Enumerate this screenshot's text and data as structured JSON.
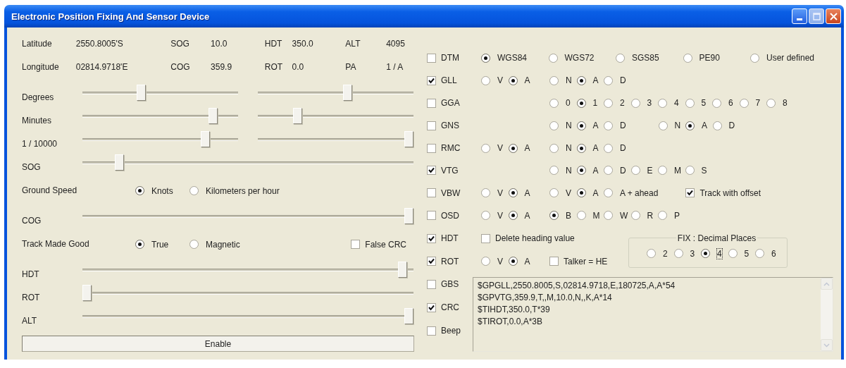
{
  "window": {
    "title": "Electronic Position Fixing And Sensor Device"
  },
  "readout_rows": [
    {
      "fields": [
        {
          "label": "Latitude",
          "value": "2550.8005'S"
        },
        {
          "label": "SOG",
          "value": "10.0"
        },
        {
          "label": "HDT",
          "value": "350.0"
        },
        {
          "label": "ALT",
          "value": "4095"
        }
      ]
    },
    {
      "fields": [
        {
          "label": "Longitude",
          "value": "02814.9718'E"
        },
        {
          "label": "COG",
          "value": "359.9"
        },
        {
          "label": "ROT",
          "value": "0.0"
        },
        {
          "label": "PA",
          "value": "1 / A"
        }
      ]
    }
  ],
  "controls": [
    {
      "kind": "slider",
      "label": "Degrees",
      "sliders": [
        {
          "level": 0.37
        },
        {
          "level": 0.58
        }
      ]
    },
    {
      "kind": "slider",
      "label": "Minutes",
      "sliders": [
        {
          "level": 0.86
        },
        {
          "level": 0.24
        }
      ]
    },
    {
      "kind": "slider",
      "label": "1 / 10000",
      "sliders": [
        {
          "level": 0.81
        },
        {
          "level": 1.0
        }
      ]
    },
    {
      "kind": "slider",
      "label": "SOG",
      "sliders": [
        {
          "level": 0.1
        }
      ]
    },
    {
      "kind": "radio",
      "label": "Ground Speed",
      "options": [
        {
          "label": "Knots",
          "selected": true
        },
        {
          "label": "Kilometers per hour",
          "selected": false
        }
      ]
    },
    {
      "kind": "slider",
      "label": "COG",
      "sliders": [
        {
          "level": 1.0
        }
      ]
    },
    {
      "kind": "radio",
      "label": "Track Made Good",
      "options": [
        {
          "label": "True",
          "selected": true
        },
        {
          "label": "Magnetic",
          "selected": false
        }
      ],
      "checkbox": {
        "label": "False CRC",
        "checked": false
      }
    },
    {
      "kind": "slider",
      "label": "HDT",
      "sliders": [
        {
          "level": 0.98
        }
      ]
    },
    {
      "kind": "slider",
      "label": "ROT",
      "sliders": [
        {
          "level": 0.0
        }
      ]
    },
    {
      "kind": "slider",
      "label": "ALT",
      "sliders": [
        {
          "level": 1.0
        }
      ]
    }
  ],
  "enable_button": {
    "label": "Enable"
  },
  "sentences": [
    {
      "name": "DTM",
      "checked": false,
      "lead": {
        "kind": "datum",
        "options": [
          {
            "label": "WGS84",
            "selected": true
          },
          {
            "label": "WGS72",
            "selected": false
          },
          {
            "label": "SGS85",
            "selected": false
          },
          {
            "label": "PE90",
            "selected": false
          },
          {
            "label": "User defined",
            "selected": false
          }
        ]
      }
    },
    {
      "name": "GLL",
      "checked": true,
      "lead": {
        "kind": "radios",
        "options": [
          {
            "label": "V",
            "selected": false
          },
          {
            "label": "A",
            "selected": true
          }
        ]
      },
      "controls": [
        {
          "kind": "radios",
          "options": [
            {
              "label": "N",
              "selected": false
            },
            {
              "label": "A",
              "selected": true
            },
            {
              "label": "D",
              "selected": false
            }
          ]
        }
      ]
    },
    {
      "name": "GGA",
      "checked": false,
      "controls": [
        {
          "kind": "radios",
          "options": [
            {
              "label": "0",
              "selected": false
            },
            {
              "label": "1",
              "selected": true
            },
            {
              "label": "2",
              "selected": false
            },
            {
              "label": "3",
              "selected": false
            },
            {
              "label": "4",
              "selected": false
            },
            {
              "label": "5",
              "selected": false
            },
            {
              "label": "6",
              "selected": false
            },
            {
              "label": "7",
              "selected": false
            },
            {
              "label": "8",
              "selected": false
            }
          ]
        }
      ]
    },
    {
      "name": "GNS",
      "checked": false,
      "controls": [
        {
          "kind": "radios",
          "options": [
            {
              "label": "N",
              "selected": false
            },
            {
              "label": "A",
              "selected": true
            },
            {
              "label": "D",
              "selected": false
            }
          ]
        },
        {
          "kind": "radios",
          "options": [
            {
              "label": "N",
              "selected": false
            },
            {
              "label": "A",
              "selected": true
            },
            {
              "label": "D",
              "selected": false
            }
          ]
        }
      ]
    },
    {
      "name": "RMC",
      "checked": false,
      "lead": {
        "kind": "radios",
        "options": [
          {
            "label": "V",
            "selected": false
          },
          {
            "label": "A",
            "selected": true
          }
        ]
      },
      "controls": [
        {
          "kind": "radios",
          "options": [
            {
              "label": "N",
              "selected": false
            },
            {
              "label": "A",
              "selected": true
            },
            {
              "label": "D",
              "selected": false
            }
          ]
        }
      ]
    },
    {
      "name": "VTG",
      "checked": true,
      "controls": [
        {
          "kind": "radios",
          "options": [
            {
              "label": "N",
              "selected": false
            },
            {
              "label": "A",
              "selected": true
            },
            {
              "label": "D",
              "selected": false
            },
            {
              "label": "E",
              "selected": false
            },
            {
              "label": "M",
              "selected": false
            },
            {
              "label": "S",
              "selected": false
            }
          ]
        }
      ]
    },
    {
      "name": "VBW",
      "checked": false,
      "lead": {
        "kind": "radios",
        "options": [
          {
            "label": "V",
            "selected": false
          },
          {
            "label": "A",
            "selected": true
          }
        ]
      },
      "controls": [
        {
          "kind": "radios",
          "options": [
            {
              "label": "V",
              "selected": false
            },
            {
              "label": "A",
              "selected": true
            },
            {
              "label": "A + ahead",
              "selected": false
            }
          ]
        },
        {
          "kind": "checkbox",
          "label": "Track with offset",
          "checked": true
        }
      ]
    },
    {
      "name": "OSD",
      "checked": false,
      "lead": {
        "kind": "radios",
        "options": [
          {
            "label": "V",
            "selected": false
          },
          {
            "label": "A",
            "selected": true
          }
        ]
      },
      "controls": [
        {
          "kind": "radios",
          "options": [
            {
              "label": "B",
              "selected": true
            },
            {
              "label": "M",
              "selected": false
            },
            {
              "label": "W",
              "selected": false
            },
            {
              "label": "R",
              "selected": false
            },
            {
              "label": "P",
              "selected": false
            }
          ]
        }
      ]
    },
    {
      "name": "HDT",
      "checked": true,
      "lead": {
        "kind": "checkbox",
        "label": "Delete heading value",
        "checked": false
      },
      "controls": [
        {
          "kind": "fieldset",
          "title": "FIX : Decimal Places",
          "options": [
            {
              "label": "2",
              "selected": false,
              "focused": false
            },
            {
              "label": "3",
              "selected": false,
              "focused": false
            },
            {
              "label": "4",
              "selected": true,
              "focused": true
            },
            {
              "label": "5",
              "selected": false,
              "focused": false
            },
            {
              "label": "6",
              "selected": false,
              "focused": false
            }
          ]
        }
      ]
    },
    {
      "name": "ROT",
      "checked": true,
      "lead": {
        "kind": "radios",
        "options": [
          {
            "label": "V",
            "selected": false
          },
          {
            "label": "A",
            "selected": true
          }
        ]
      },
      "controls": [
        {
          "kind": "checkbox",
          "label": "Talker = HE",
          "checked": false
        }
      ]
    }
  ],
  "options": [
    {
      "name": "GBS",
      "checked": false
    },
    {
      "name": "CRC",
      "checked": true
    },
    {
      "name": "Beep",
      "checked": false
    }
  ],
  "output": {
    "lines": [
      "$GPGLL,2550.8005,S,02814.9718,E,180725,A,A*54",
      "$GPVTG,359.9,T,,M,10.0,N,,K,A*14",
      "$TIHDT,350.0,T*39",
      "$TIROT,0.0,A*3B"
    ]
  }
}
